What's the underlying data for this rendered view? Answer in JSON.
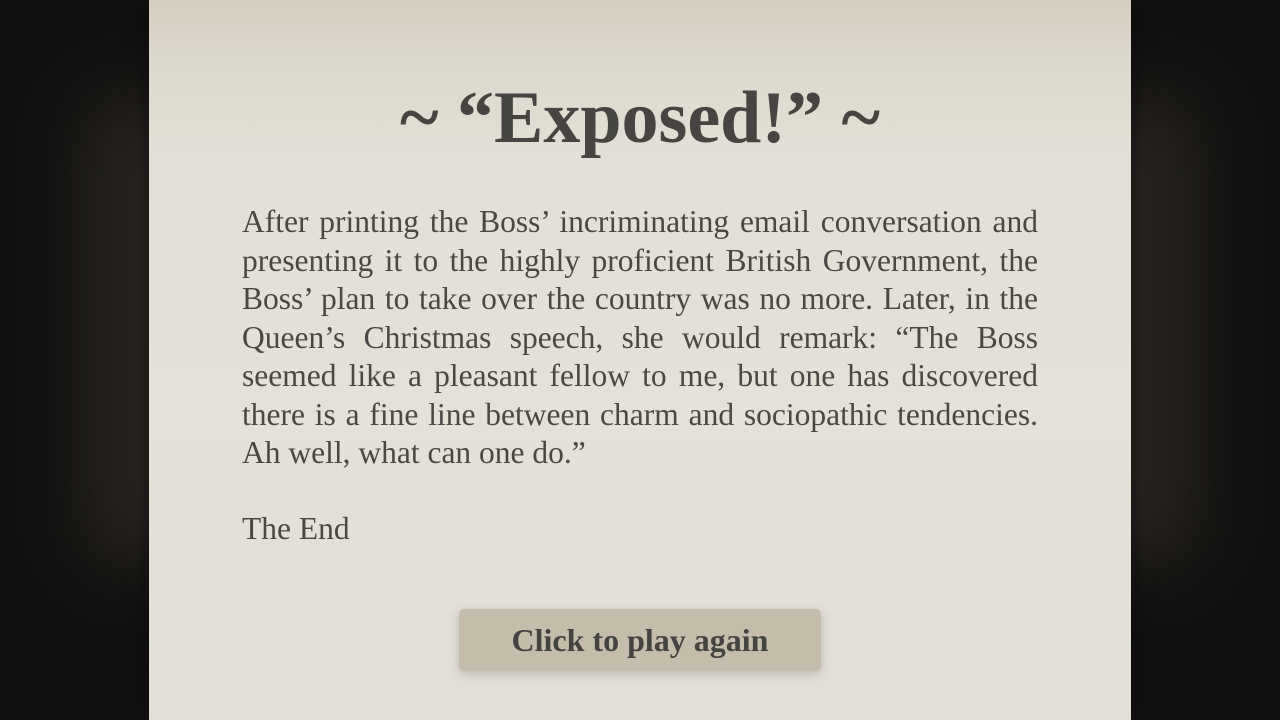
{
  "screen": {
    "title": "~ “Exposed!” ~",
    "body": "After printing the Boss’ incriminating email conversation and presenting it to the highly proficient British Government, the Boss’ plan to take over the country was no more. Later, in the Queen’s Christmas speech, she would remark: “The Boss seemed like a pleasant fellow to me, but one has discovered there is a fine line between charm and sociopathic tendencies. Ah well, what can one do.”",
    "ending": "The End",
    "play_again_label": "Click to play again"
  },
  "colors": {
    "page_background": "#121110",
    "card_background": "#e2dfd7",
    "text": "#4a4844",
    "button_background": "#c4bdab"
  }
}
